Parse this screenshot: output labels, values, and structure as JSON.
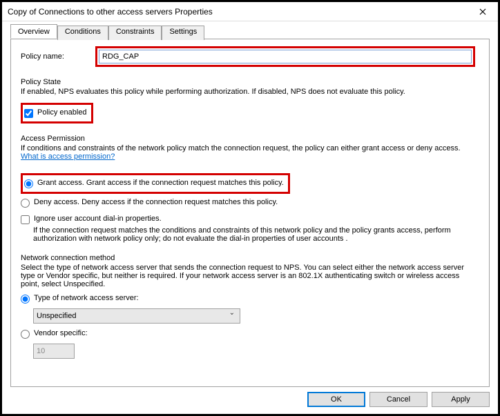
{
  "window": {
    "title": "Copy of Connections to other access servers Properties"
  },
  "tabs": {
    "overview": "Overview",
    "conditions": "Conditions",
    "constraints": "Constraints",
    "settings": "Settings"
  },
  "policyName": {
    "label": "Policy name:",
    "value": "RDG_CAP"
  },
  "policyState": {
    "title": "Policy State",
    "desc": "If enabled, NPS evaluates this policy while performing authorization. If disabled, NPS does not evaluate this policy.",
    "enabledLabel": "Policy enabled"
  },
  "accessPermission": {
    "title": "Access Permission",
    "desc": "If conditions and constraints of the network policy match the connection request, the policy can either grant access or deny access. ",
    "link": "What is access permission?",
    "grant": "Grant access. Grant access if the connection request matches this policy.",
    "deny": "Deny access. Deny access if the connection request matches this policy.",
    "ignore": "Ignore user account dial-in properties.",
    "ignoreDesc": "If the connection request matches the conditions and constraints of this network policy and the policy grants access, perform authorization with network policy only; do not evaluate the dial-in properties of user accounts ."
  },
  "netConn": {
    "title": "Network connection method",
    "desc": "Select the type of network access server that sends the connection request to NPS. You can select either the network access server type or Vendor specific, but neither is required.  If your network access server is an 802.1X authenticating switch or wireless access point, select Unspecified.",
    "typeLabel": "Type of network access server:",
    "typeValue": "Unspecified",
    "vendorLabel": "Vendor specific:",
    "vendorValue": "10"
  },
  "buttons": {
    "ok": "OK",
    "cancel": "Cancel",
    "apply": "Apply"
  }
}
